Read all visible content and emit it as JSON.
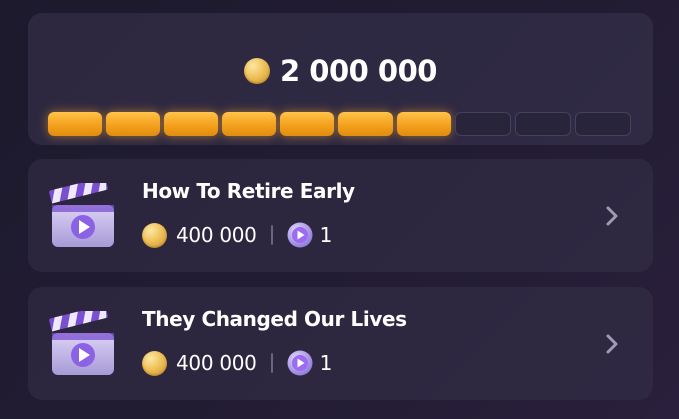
{
  "reward": {
    "total": "2 000 000",
    "progress_filled": 7,
    "progress_total": 10
  },
  "items": [
    {
      "title": "How To Retire Early",
      "coins": "400 000",
      "plays": "1"
    },
    {
      "title": "They Changed Our Lives",
      "coins": "400 000",
      "plays": "1"
    }
  ],
  "icons": {
    "coin": "coin-icon",
    "clapperboard": "clapperboard-icon",
    "play_badge": "play-badge-icon",
    "chevron": "chevron-right-icon"
  },
  "colors": {
    "progress_fill": "#f4a11e",
    "coin": "#eec25b",
    "accent_purple": "#8b62e6"
  }
}
